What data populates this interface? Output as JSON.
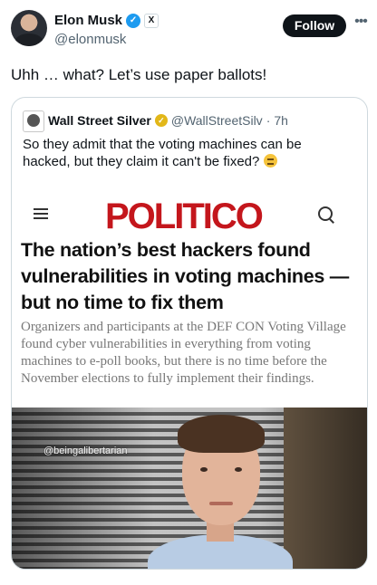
{
  "author": {
    "name": "Elon Musk",
    "handle": "@elonmusk",
    "verified_icon": "verified-badge-icon",
    "affiliation_icon": "x-logo-icon",
    "follow_label": "Follow",
    "more_icon": "more-icon"
  },
  "tweet": {
    "text": "Uhh … what? Let’s use paper ballots!"
  },
  "quoted": {
    "name": "Wall Street Silver",
    "handle": "@WallStreetSilv",
    "separator": "·",
    "time": "7h",
    "verified_icon": "gold-verified-icon",
    "text": "So they admit that the voting machines can be hacked, but they claim it can't be fixed?",
    "emoji": "face-with-raised-eyebrow-emoji"
  },
  "article": {
    "logo": "POLITICO",
    "menu_icon": "hamburger-menu-icon",
    "search_icon": "search-icon",
    "headline": "The nation’s best hackers found vulnerabilities in voting machines — but no time to fix them",
    "dek": "Organizers and participants at the DEF CON Voting Village found cyber vulnerabilities in everything from voting machines to e-poll books, but there is no time before the November elections to fully implement their findings."
  },
  "photo": {
    "watermark": "@beingalibertarian"
  },
  "colors": {
    "verified_blue": "#1d9bf0",
    "gold_badge": "#e2b719",
    "politico_red": "#c4161c",
    "follow_bg": "#0f1419"
  }
}
